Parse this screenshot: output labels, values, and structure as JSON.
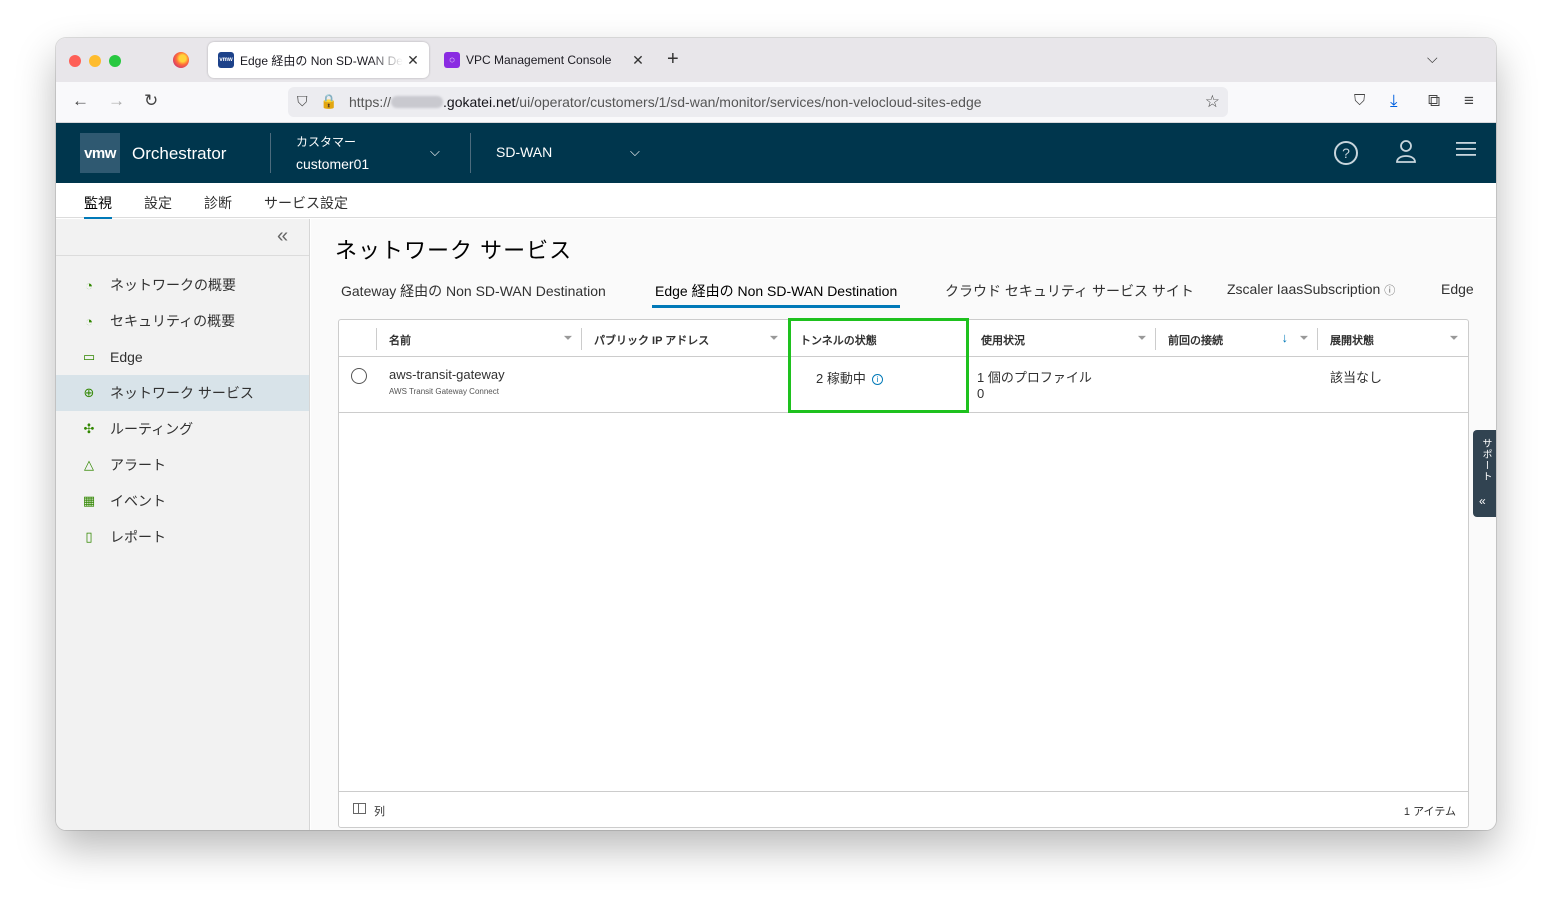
{
  "browser": {
    "tabs": [
      {
        "title": "Edge 経由の Non SD-WAN Destination",
        "favicon": "vmw",
        "close": "✕"
      },
      {
        "title": "VPC Management Console",
        "favicon": "vpc",
        "close": "✕"
      }
    ],
    "new_tab": "+",
    "tab_list": "⌵",
    "url": {
      "scheme": "https://",
      "domain": ".gokatei.net",
      "path": "/ui/operator/customers/1/sd-wan/monitor/services/non-velocloud-sites-edge"
    }
  },
  "header": {
    "logo": "vmw",
    "app_title": "Orchestrator",
    "customer_label": "カスタマー",
    "customer_value": "customer01",
    "product": "SD-WAN",
    "help": "?",
    "colors": {
      "bg": "#00364d",
      "accent": "#0079b8"
    }
  },
  "subnav": [
    "監視",
    "設定",
    "診断",
    "サービス設定"
  ],
  "sidebar": {
    "collapse": "«",
    "items": [
      {
        "label": "ネットワークの概要",
        "icon": "gauge-icon",
        "glyph": "◔"
      },
      {
        "label": "セキュリティの概要",
        "icon": "gauge-icon",
        "glyph": "◔"
      },
      {
        "label": "Edge",
        "icon": "edge-device-icon",
        "glyph": "▭"
      },
      {
        "label": "ネットワーク サービス",
        "icon": "network-services-icon",
        "glyph": "⊕"
      },
      {
        "label": "ルーティング",
        "icon": "routing-icon",
        "glyph": "✣"
      },
      {
        "label": "アラート",
        "icon": "alert-icon",
        "glyph": "△"
      },
      {
        "label": "イベント",
        "icon": "calendar-icon",
        "glyph": "▦"
      },
      {
        "label": "レポート",
        "icon": "report-icon",
        "glyph": "▯"
      }
    ]
  },
  "main": {
    "title": "ネットワーク サービス",
    "tabs": [
      "Gateway 経由の Non SD-WAN Destination",
      "Edge 経由の Non SD-WAN Destination",
      "クラウド セキュリティ サービス サイト",
      "Zscaler IaasSubscription",
      "Edge"
    ],
    "zscaler_info": "ⓘ",
    "grid": {
      "columns": [
        "名前",
        "パブリック IP アドレス",
        "トンネルの状態",
        "使用状況",
        "前回の接続",
        "展開状態"
      ],
      "sort_icon": "↓",
      "filter_icon": "⏷",
      "rows": [
        {
          "name": "aws-transit-gateway",
          "name_sub": "AWS Transit Gateway Connect",
          "public_ip": "",
          "tunnel_state": "2 稼動中",
          "info": "i",
          "usage_line1": "1 個のプロファイル",
          "usage_line2": "0",
          "last_contact": "",
          "deploy_state": "該当なし"
        }
      ],
      "columns_button": "列",
      "item_count": "1 アイテム"
    },
    "support_tab": "サポート",
    "support_chev": "«"
  }
}
